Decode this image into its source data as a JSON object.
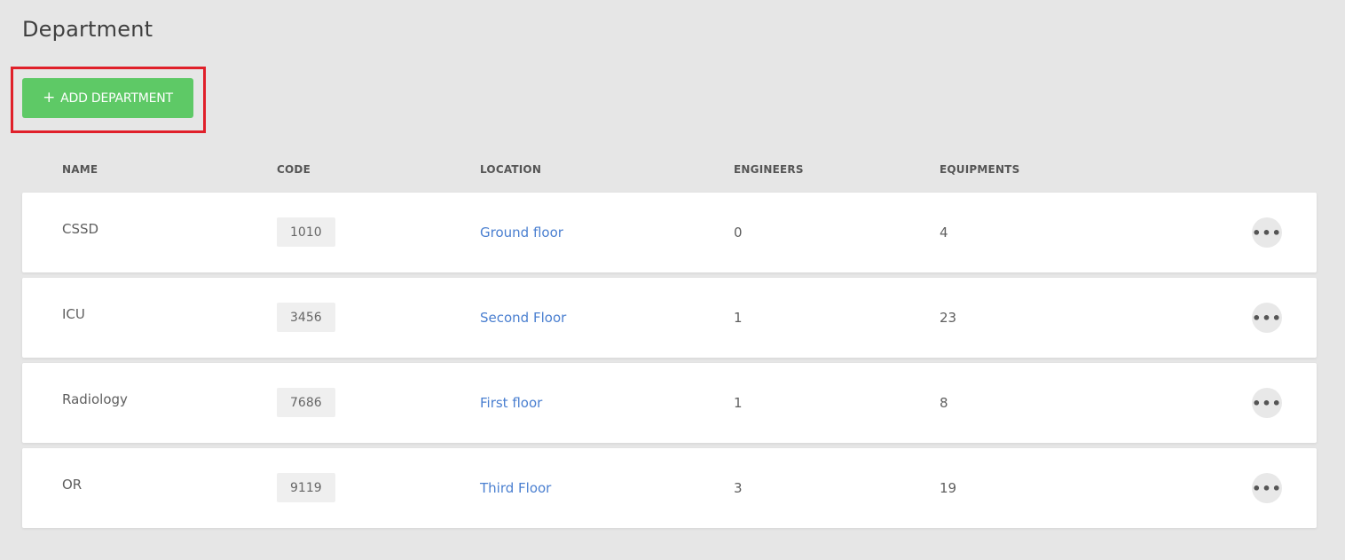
{
  "page": {
    "title": "Department"
  },
  "toolbar": {
    "add_icon": "+",
    "add_label": "ADD DEPARTMENT"
  },
  "table": {
    "headers": {
      "name": "NAME",
      "code": "CODE",
      "location": "LOCATION",
      "engineers": "ENGINEERS",
      "equipments": "EQUIPMENTS"
    },
    "rows": [
      {
        "name": "CSSD",
        "code": "1010",
        "location": "Ground floor",
        "engineers": "0",
        "equipments": "4"
      },
      {
        "name": "ICU",
        "code": "3456",
        "location": "Second Floor",
        "engineers": "1",
        "equipments": "23"
      },
      {
        "name": "Radiology",
        "code": "7686",
        "location": "First floor",
        "engineers": "1",
        "equipments": "8"
      },
      {
        "name": "OR",
        "code": "9119",
        "location": "Third Floor",
        "engineers": "3",
        "equipments": "19"
      }
    ],
    "row_action_icon": "•••"
  },
  "colors": {
    "background": "#e6e6e6",
    "accent_green": "#5ec966",
    "link_blue": "#4a7fd0",
    "highlight_red": "#e0202a"
  }
}
